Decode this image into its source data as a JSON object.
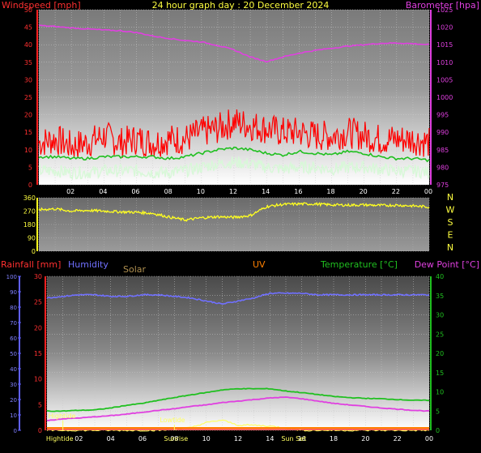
{
  "title": "24 hour graph day : 20 December 2024",
  "colors": {
    "background": "#000000",
    "windspeed": "#ff2020",
    "gust": "#ff0000",
    "average_wind": "#20c020",
    "wind_low": "#d8f8d8",
    "barometer": "#e040e0",
    "direction": "#ffff20",
    "rainfall": "#ff3030",
    "humidity": "#7070ff",
    "solar": "#b09050",
    "uv": "#ff8000",
    "temperature": "#20c020",
    "dewpoint": "#e040e0",
    "tide": "#ffff60",
    "axis_green": "#20c020",
    "axis_blue": "#6060ff"
  },
  "x_ticks": [
    "02",
    "04",
    "06",
    "08",
    "10",
    "12",
    "14",
    "16",
    "18",
    "20",
    "22",
    "00"
  ],
  "chart_data": [
    {
      "type": "line",
      "name": "wind-barometer",
      "title": "24 hour graph day : 20 December 2024",
      "ylabel_left": "Windspeed [mph]",
      "ylabel_right": "Barometer [hpa]",
      "y_left_ticks": [
        "0",
        "5",
        "10",
        "15",
        "20",
        "25",
        "30",
        "35",
        "40",
        "45",
        "50"
      ],
      "y_right_ticks": [
        "975",
        "980",
        "985",
        "990",
        "995",
        "1000",
        "1005",
        "1010",
        "1015",
        "1020",
        "1025"
      ],
      "ylim_left": [
        0,
        50
      ],
      "ylim_right": [
        975,
        1025
      ],
      "x_hours": [
        0,
        1,
        2,
        3,
        4,
        5,
        6,
        7,
        8,
        9,
        10,
        11,
        12,
        13,
        14,
        15,
        16,
        17,
        18,
        19,
        20,
        21,
        22,
        23,
        24
      ],
      "series": [
        {
          "name": "Barometer",
          "axis": "right",
          "values": [
            1020.5,
            1020.2,
            1019.8,
            1019.5,
            1019.2,
            1019.0,
            1018.5,
            1017.5,
            1016.8,
            1016.2,
            1015.8,
            1014.8,
            1013.5,
            1011.5,
            1010.2,
            1011.5,
            1012.6,
            1013.4,
            1014.0,
            1014.6,
            1015.0,
            1015.4,
            1015.5,
            1015.3,
            1015.0
          ]
        },
        {
          "name": "Gust",
          "axis": "left",
          "values": [
            12,
            13,
            11,
            12,
            14,
            12,
            13,
            12,
            13,
            13,
            15,
            16,
            18,
            17,
            16,
            15,
            15,
            14,
            14,
            15,
            14,
            13,
            13,
            13,
            12
          ]
        },
        {
          "name": "Average",
          "axis": "left",
          "values": [
            8,
            8,
            7.5,
            7.5,
            8,
            8,
            8,
            8,
            7.5,
            8,
            9,
            10,
            10.5,
            10,
            9,
            8.5,
            9.5,
            9,
            8.5,
            9.5,
            9,
            8,
            7.5,
            7.5,
            7
          ]
        },
        {
          "name": "Windspeed low",
          "axis": "left",
          "values": [
            4,
            4,
            3.5,
            3.5,
            4,
            4,
            4,
            3.5,
            3.5,
            4,
            5,
            6,
            6.5,
            6,
            5,
            4.5,
            5,
            5,
            4.5,
            5,
            5,
            4.5,
            4,
            4,
            3.5
          ]
        }
      ]
    },
    {
      "type": "line",
      "name": "wind-direction",
      "y_ticks": [
        "0",
        "90",
        "180",
        "270",
        "360"
      ],
      "compass": [
        "N",
        "W",
        "S",
        "E",
        "N"
      ],
      "ylim": [
        0,
        360
      ],
      "x_hours": [
        0,
        1,
        2,
        3,
        4,
        5,
        6,
        7,
        8,
        9,
        10,
        11,
        12,
        13,
        14,
        15,
        16,
        17,
        18,
        19,
        20,
        21,
        22,
        23,
        24
      ],
      "series": [
        {
          "name": "Direction",
          "values": [
            280,
            285,
            270,
            275,
            270,
            265,
            262,
            255,
            230,
            210,
            225,
            232,
            228,
            240,
            300,
            315,
            318,
            318,
            312,
            310,
            312,
            308,
            310,
            305,
            298
          ]
        }
      ]
    },
    {
      "type": "line",
      "name": "rain-humidity-temp",
      "labels": {
        "rainfall": "Rainfall [mm]",
        "humidity": "Humidity",
        "solar": "Solar",
        "uv": "UV",
        "temperature": "Temperature [°C]",
        "dewpoint": "Dew Point [°C]"
      },
      "y_humidity_ticks": [
        "0",
        "10",
        "20",
        "30",
        "40",
        "50",
        "60",
        "70",
        "80",
        "90",
        "100"
      ],
      "y_rain_ticks": [
        "0",
        "5",
        "10",
        "15",
        "20",
        "25",
        "30"
      ],
      "y_temp_ticks": [
        "0",
        "5",
        "10",
        "15",
        "20",
        "25",
        "30",
        "35",
        "40"
      ],
      "ylim_humidity": [
        0,
        100
      ],
      "ylim_rain": [
        0,
        30
      ],
      "ylim_temp": [
        0,
        40
      ],
      "x_hours": [
        0,
        1,
        2,
        3,
        4,
        5,
        6,
        7,
        8,
        9,
        10,
        11,
        12,
        13,
        14,
        15,
        16,
        17,
        18,
        19,
        20,
        21,
        22,
        23,
        24
      ],
      "series": [
        {
          "name": "Humidity",
          "axis": "humidity",
          "values": [
            86,
            87,
            88,
            88,
            87,
            87,
            88,
            88,
            87,
            86,
            84,
            82,
            84,
            86,
            89,
            89,
            89,
            88,
            88,
            88,
            88,
            88,
            88,
            88,
            88
          ]
        },
        {
          "name": "Temperature",
          "axis": "temp",
          "values": [
            5,
            5,
            5.2,
            5.3,
            5.8,
            6.5,
            7,
            7.8,
            8.5,
            9.2,
            9.8,
            10.5,
            10.8,
            10.8,
            10.8,
            10.2,
            9.8,
            9.3,
            8.8,
            8.5,
            8.3,
            8.2,
            8.0,
            7.8,
            7.8
          ]
        },
        {
          "name": "Dew Point",
          "axis": "temp",
          "values": [
            2.5,
            3,
            3.2,
            3.5,
            3.8,
            4.2,
            4.7,
            5.2,
            5.6,
            6.2,
            6.6,
            7.2,
            7.6,
            8,
            8.4,
            8.6,
            8.2,
            7.6,
            7,
            6.6,
            6.2,
            5.8,
            5.5,
            5.2,
            5.0
          ]
        },
        {
          "name": "Solar",
          "axis": "rain",
          "values": [
            0,
            0,
            0,
            0,
            0,
            0,
            0,
            0,
            0.2,
            0.5,
            1.5,
            2.0,
            1.0,
            1.0,
            0.8,
            0.5,
            0.0,
            0,
            0,
            0,
            0,
            0,
            0,
            0,
            0
          ]
        },
        {
          "name": "Rainfall",
          "axis": "rain",
          "values": [
            0,
            0,
            0,
            0,
            0,
            0,
            0,
            0,
            0,
            0,
            0,
            0,
            0,
            0,
            0,
            0,
            0,
            0,
            0,
            0,
            0,
            0,
            0,
            0,
            0
          ]
        }
      ],
      "annotations": [
        {
          "label": "Hightide",
          "hour": 1.0
        },
        {
          "label": "Lowtide",
          "hour": 8.0
        },
        {
          "label": "Sunrise",
          "hour": 8.1
        },
        {
          "label": "Sun Set",
          "hour": 15.9
        }
      ],
      "tick_labels_bottom": [
        {
          "label": "Hightide",
          "hour": 0.8
        },
        {
          "label": "Sunrise",
          "hour": 8.1
        },
        {
          "label": "Sun Set",
          "hour": 15.5
        }
      ]
    }
  ]
}
